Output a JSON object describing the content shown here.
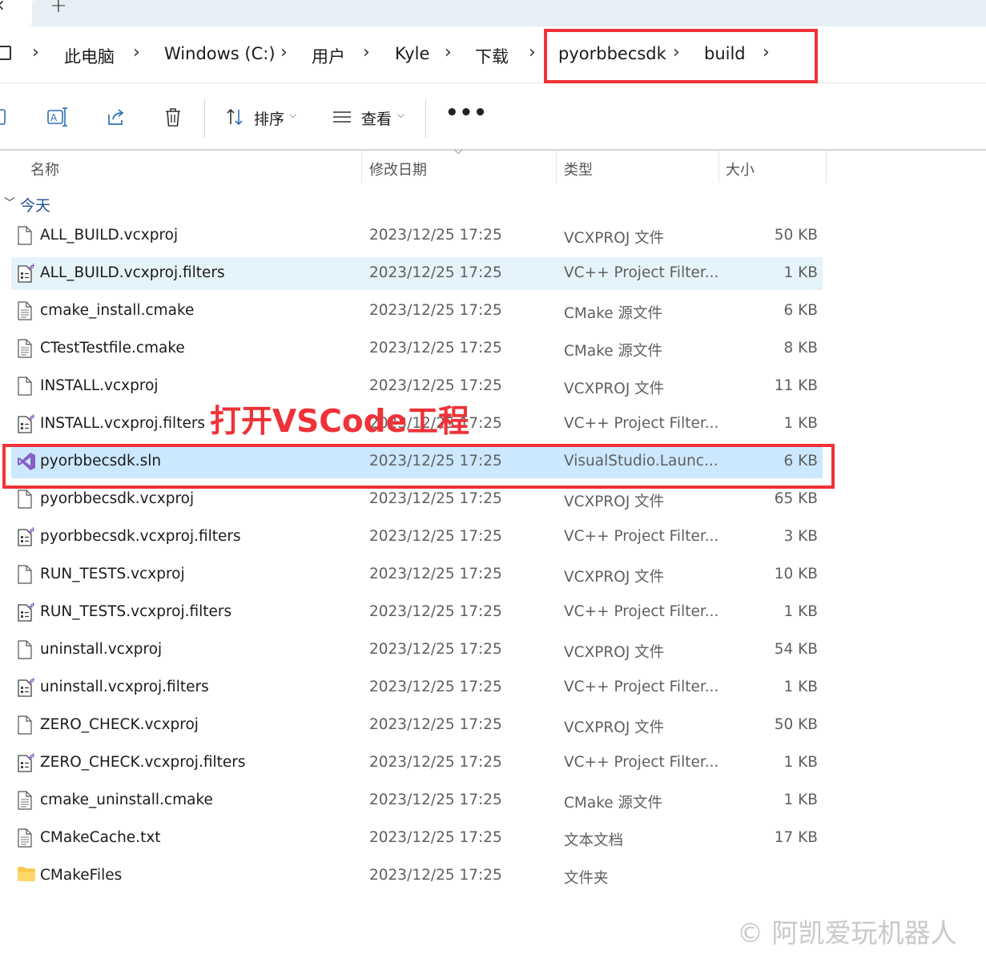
{
  "tabbar": {
    "close_glyph": "×",
    "add_glyph": "+"
  },
  "address": {
    "separator": "›",
    "crumbs": [
      {
        "label": "此电脑"
      },
      {
        "label": "Windows (C:)"
      },
      {
        "label": "用户"
      },
      {
        "label": "Kyle"
      },
      {
        "label": "下载"
      },
      {
        "label": "pyorbbecsdk"
      },
      {
        "label": "build"
      }
    ]
  },
  "toolbar": {
    "sort_label": "排序",
    "view_label": "查看",
    "more_label": "•••",
    "icons": [
      "copy-icon",
      "rename-icon",
      "share-icon",
      "delete-icon",
      "sort-icon",
      "view-icon"
    ]
  },
  "columns": {
    "name": "名称",
    "date": "修改日期",
    "type": "类型",
    "size": "大小"
  },
  "group": {
    "label": "今天"
  },
  "files": [
    {
      "name": "ALL_BUILD.vcxproj",
      "date": "2023/12/25 17:25",
      "type": "VCXPROJ 文件",
      "size": "50 KB",
      "icon": "file-icon",
      "state": ""
    },
    {
      "name": "ALL_BUILD.vcxproj.filters",
      "date": "2023/12/25 17:25",
      "type": "VC++ Project Filter...",
      "size": "1 KB",
      "icon": "filters-file-icon",
      "state": "hover"
    },
    {
      "name": "cmake_install.cmake",
      "date": "2023/12/25 17:25",
      "type": "CMake 源文件",
      "size": "6 KB",
      "icon": "text-file-icon",
      "state": ""
    },
    {
      "name": "CTestTestfile.cmake",
      "date": "2023/12/25 17:25",
      "type": "CMake 源文件",
      "size": "8 KB",
      "icon": "text-file-icon",
      "state": ""
    },
    {
      "name": "INSTALL.vcxproj",
      "date": "2023/12/25 17:25",
      "type": "VCXPROJ 文件",
      "size": "11 KB",
      "icon": "file-icon",
      "state": ""
    },
    {
      "name": "INSTALL.vcxproj.filters",
      "date": "2023/12/25 17:25",
      "type": "VC++ Project Filter...",
      "size": "1 KB",
      "icon": "filters-file-icon",
      "state": ""
    },
    {
      "name": "pyorbbecsdk.sln",
      "date": "2023/12/25 17:25",
      "type": "VisualStudio.Launc...",
      "size": "6 KB",
      "icon": "visual-studio-icon",
      "state": "selected"
    },
    {
      "name": "pyorbbecsdk.vcxproj",
      "date": "2023/12/25 17:25",
      "type": "VCXPROJ 文件",
      "size": "65 KB",
      "icon": "file-icon",
      "state": ""
    },
    {
      "name": "pyorbbecsdk.vcxproj.filters",
      "date": "2023/12/25 17:25",
      "type": "VC++ Project Filter...",
      "size": "3 KB",
      "icon": "filters-file-icon",
      "state": ""
    },
    {
      "name": "RUN_TESTS.vcxproj",
      "date": "2023/12/25 17:25",
      "type": "VCXPROJ 文件",
      "size": "10 KB",
      "icon": "file-icon",
      "state": ""
    },
    {
      "name": "RUN_TESTS.vcxproj.filters",
      "date": "2023/12/25 17:25",
      "type": "VC++ Project Filter...",
      "size": "1 KB",
      "icon": "filters-file-icon",
      "state": ""
    },
    {
      "name": "uninstall.vcxproj",
      "date": "2023/12/25 17:25",
      "type": "VCXPROJ 文件",
      "size": "54 KB",
      "icon": "file-icon",
      "state": ""
    },
    {
      "name": "uninstall.vcxproj.filters",
      "date": "2023/12/25 17:25",
      "type": "VC++ Project Filter...",
      "size": "1 KB",
      "icon": "filters-file-icon",
      "state": ""
    },
    {
      "name": "ZERO_CHECK.vcxproj",
      "date": "2023/12/25 17:25",
      "type": "VCXPROJ 文件",
      "size": "50 KB",
      "icon": "file-icon",
      "state": ""
    },
    {
      "name": "ZERO_CHECK.vcxproj.filters",
      "date": "2023/12/25 17:25",
      "type": "VC++ Project Filter...",
      "size": "1 KB",
      "icon": "filters-file-icon",
      "state": ""
    },
    {
      "name": "cmake_uninstall.cmake",
      "date": "2023/12/25 17:25",
      "type": "CMake 源文件",
      "size": "1 KB",
      "icon": "text-file-icon",
      "state": ""
    },
    {
      "name": "CMakeCache.txt",
      "date": "2023/12/25 17:25",
      "type": "文本文档",
      "size": "17 KB",
      "icon": "text-file-icon",
      "state": ""
    },
    {
      "name": "CMakeFiles",
      "date": "2023/12/25 17:25",
      "type": "文件夹",
      "size": "",
      "icon": "folder-icon",
      "state": ""
    }
  ],
  "annotation": {
    "text": "打开VSCode工程",
    "color": "#ef3237"
  },
  "watermark": {
    "text": "© 阿凯爱玩机器人"
  },
  "colors": {
    "selected": "#cce8ff",
    "hover": "#e5f3fb",
    "highlight_box": "#ef3237",
    "group_label": "#1f4f8f"
  }
}
